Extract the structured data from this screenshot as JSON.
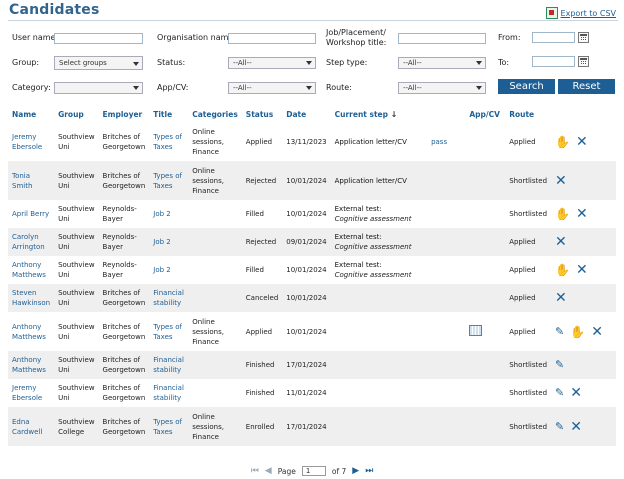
{
  "page": {
    "title": "Candidates",
    "export_label": "Export to CSV"
  },
  "filters": {
    "user_name_label": "User name:",
    "org_name_label": "Organisation name:",
    "job_title_label": "Job/Placement/ Workshop title:",
    "from_label": "From:",
    "group_label": "Group:",
    "group_value": "Select groups",
    "status_label": "Status:",
    "status_value": "--All--",
    "step_type_label": "Step type:",
    "step_type_value": "--All--",
    "to_label": "To:",
    "category_label": "Category:",
    "category_value": "",
    "appcv_label": "App/CV:",
    "appcv_value": "--All--",
    "route_label": "Route:",
    "route_value": "--All--",
    "search_label": "Search",
    "reset_label": "Reset"
  },
  "table": {
    "headers": [
      "Name",
      "Group",
      "Employer",
      "Title",
      "Categories",
      "Status",
      "Date",
      "Current step",
      "App/CV",
      "Route"
    ],
    "sort_indicator": "↓",
    "rows": [
      {
        "name": "Jeremy Ebersole",
        "group": "Southview Uni",
        "employer": "Britches of Georgetown",
        "title": "Types of Taxes",
        "categories": "Online sessions, Finance",
        "status": "Applied",
        "date": "13/11/2023",
        "step": "Application letter/CV",
        "step_detail": "",
        "appcv": "pass",
        "route": "Applied",
        "actions": [
          "hand",
          "x"
        ]
      },
      {
        "name": "Tonia Smith",
        "group": "Southview Uni",
        "employer": "Britches of Georgetown",
        "title": "Types of Taxes",
        "categories": "Online sessions, Finance",
        "status": "Rejected",
        "date": "10/01/2024",
        "step": "Application letter/CV",
        "step_detail": "",
        "appcv": "",
        "route": "Shortlisted",
        "actions": [
          "x"
        ]
      },
      {
        "name": "April Berry",
        "group": "Southview Uni",
        "employer": "Reynolds-Bayer",
        "title": "Job 2",
        "categories": "",
        "status": "Filled",
        "date": "10/01/2024",
        "step": "External test:",
        "step_detail": "Cognitive assessment",
        "appcv": "",
        "route": "Shortlisted",
        "actions": [
          "hand",
          "x"
        ]
      },
      {
        "name": "Carolyn Arrington",
        "group": "Southview Uni",
        "employer": "Reynolds-Bayer",
        "title": "Job 2",
        "categories": "",
        "status": "Rejected",
        "date": "09/01/2024",
        "step": "External test:",
        "step_detail": "Cognitive assessment",
        "appcv": "",
        "route": "Applied",
        "actions": [
          "x"
        ]
      },
      {
        "name": "Anthony Matthews",
        "group": "Southview Uni",
        "employer": "Reynolds-Bayer",
        "title": "Job 2",
        "categories": "",
        "status": "Filled",
        "date": "10/01/2024",
        "step": "External test:",
        "step_detail": "Cognitive assessment",
        "appcv": "",
        "route": "Applied",
        "actions": [
          "hand",
          "x"
        ]
      },
      {
        "name": "Steven Hawkinson",
        "group": "Southview Uni",
        "employer": "Britches of Georgetown",
        "title": "Financial stability",
        "categories": "",
        "status": "Canceled",
        "date": "10/01/2024",
        "step": "",
        "step_detail": "",
        "appcv": "",
        "route": "Applied",
        "actions": [
          "x"
        ]
      },
      {
        "name": "Anthony Matthews",
        "group": "Southview Uni",
        "employer": "Britches of Georgetown",
        "title": "Types of Taxes",
        "categories": "Online sessions, Finance",
        "status": "Applied",
        "date": "10/01/2024",
        "step": "",
        "step_detail": "",
        "appcv": "icon",
        "route": "Applied",
        "actions": [
          "pen",
          "hand",
          "x"
        ]
      },
      {
        "name": "Anthony Matthews",
        "group": "Southview Uni",
        "employer": "Britches of Georgetown",
        "title": "Financial stability",
        "categories": "",
        "status": "Finished",
        "date": "17/01/2024",
        "step": "",
        "step_detail": "",
        "appcv": "",
        "route": "Shortlisted",
        "actions": [
          "pen"
        ]
      },
      {
        "name": "Jeremy Ebersole",
        "group": "Southview Uni",
        "employer": "Britches of Georgetown",
        "title": "Financial stability",
        "categories": "",
        "status": "Finished",
        "date": "11/01/2024",
        "step": "",
        "step_detail": "",
        "appcv": "",
        "route": "Shortlisted",
        "actions": [
          "pen",
          "x"
        ]
      },
      {
        "name": "Edna Cardwell",
        "group": "Southview College",
        "employer": "Britches of Georgetown",
        "title": "Types of Taxes",
        "categories": "Online sessions, Finance",
        "status": "Enrolled",
        "date": "17/01/2024",
        "step": "",
        "step_detail": "",
        "appcv": "",
        "route": "Shortlisted",
        "actions": [
          "pen",
          "x"
        ]
      }
    ]
  },
  "pager": {
    "page_label": "Page",
    "current": "1",
    "of_label": "of 7"
  },
  "colors": {
    "accent": "#1d5f95",
    "title": "#31658e",
    "row_alt": "#efefef"
  }
}
